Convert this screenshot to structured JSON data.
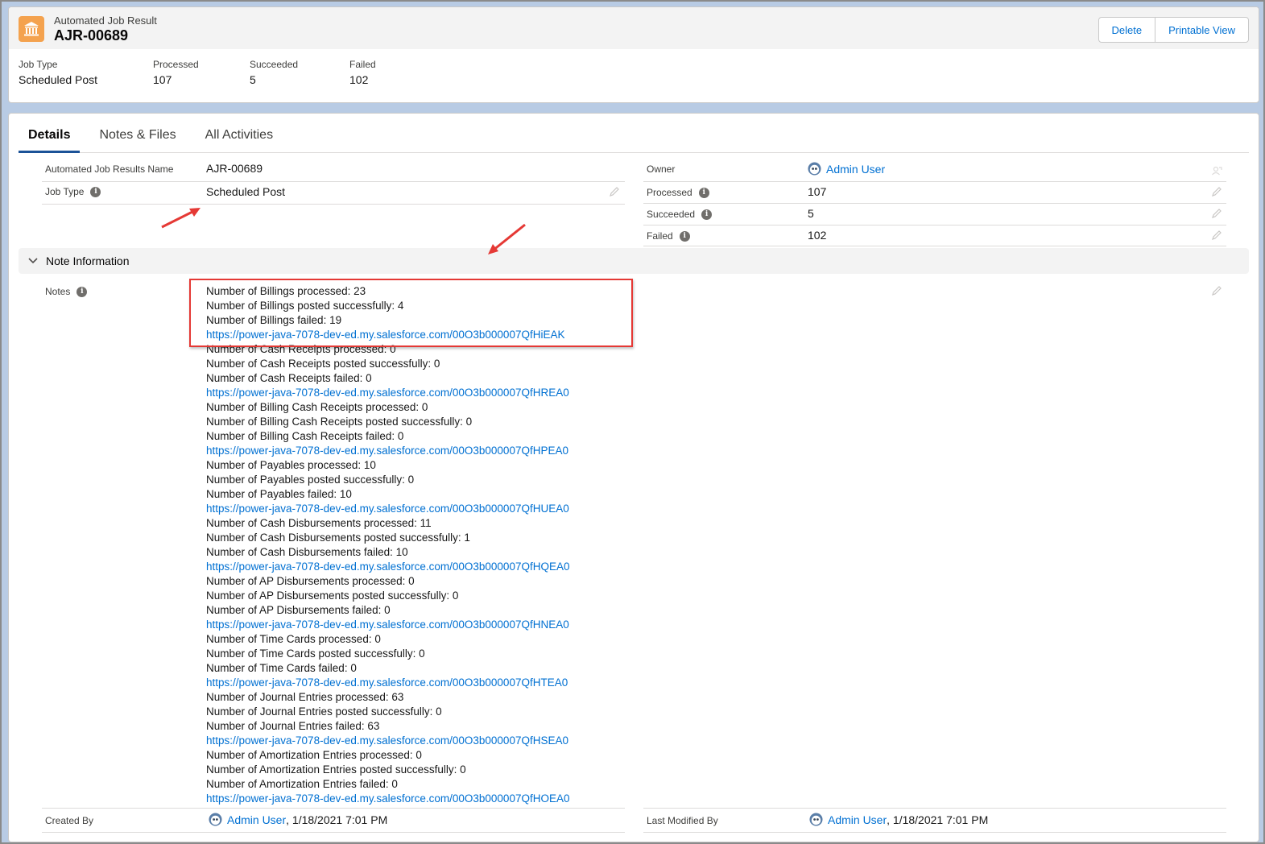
{
  "header": {
    "object_label": "Automated Job Result",
    "record_name": "AJR-00689",
    "buttons": {
      "delete": "Delete",
      "printable_view": "Printable View"
    },
    "highlights": [
      {
        "label": "Job Type",
        "value": "Scheduled Post"
      },
      {
        "label": "Processed",
        "value": "107"
      },
      {
        "label": "Succeeded",
        "value": "5"
      },
      {
        "label": "Failed",
        "value": "102"
      }
    ]
  },
  "tabs": [
    {
      "label": "Details",
      "active": true
    },
    {
      "label": "Notes & Files",
      "active": false
    },
    {
      "label": "All Activities",
      "active": false
    }
  ],
  "details": {
    "name_label": "Automated Job Results Name",
    "name_value": "AJR-00689",
    "job_type_label": "Job Type",
    "job_type_value": "Scheduled Post",
    "owner_label": "Owner",
    "owner_value": "Admin User",
    "processed_label": "Processed",
    "processed_value": "107",
    "succeeded_label": "Succeeded",
    "succeeded_value": "5",
    "failed_label": "Failed",
    "failed_value": "102"
  },
  "note_section": {
    "title": "Note Information",
    "notes_label": "Notes",
    "lines": [
      {
        "text": "Number of Billings processed: 23",
        "link": false
      },
      {
        "text": "Number of Billings posted successfully: 4",
        "link": false
      },
      {
        "text": "Number of Billings failed: 19",
        "link": false
      },
      {
        "text": "https://power-java-7078-dev-ed.my.salesforce.com/00O3b000007QfHiEAK",
        "link": true
      },
      {
        "text": "Number of Cash Receipts processed: 0",
        "link": false
      },
      {
        "text": "Number of Cash Receipts posted successfully: 0",
        "link": false
      },
      {
        "text": "Number of Cash Receipts failed: 0",
        "link": false
      },
      {
        "text": "https://power-java-7078-dev-ed.my.salesforce.com/00O3b000007QfHREA0",
        "link": true
      },
      {
        "text": "Number of Billing Cash Receipts processed: 0",
        "link": false
      },
      {
        "text": "Number of Billing Cash Receipts posted successfully: 0",
        "link": false
      },
      {
        "text": "Number of Billing Cash Receipts failed: 0",
        "link": false
      },
      {
        "text": "https://power-java-7078-dev-ed.my.salesforce.com/00O3b000007QfHPEA0",
        "link": true
      },
      {
        "text": "Number of Payables processed: 10",
        "link": false
      },
      {
        "text": "Number of Payables posted successfully: 0",
        "link": false
      },
      {
        "text": "Number of Payables failed: 10",
        "link": false
      },
      {
        "text": "https://power-java-7078-dev-ed.my.salesforce.com/00O3b000007QfHUEA0",
        "link": true
      },
      {
        "text": "Number of Cash Disbursements processed: 11",
        "link": false
      },
      {
        "text": "Number of Cash Disbursements posted successfully: 1",
        "link": false
      },
      {
        "text": "Number of Cash Disbursements failed: 10",
        "link": false
      },
      {
        "text": "https://power-java-7078-dev-ed.my.salesforce.com/00O3b000007QfHQEA0",
        "link": true
      },
      {
        "text": "Number of AP Disbursements processed: 0",
        "link": false
      },
      {
        "text": "Number of AP Disbursements posted successfully: 0",
        "link": false
      },
      {
        "text": "Number of AP Disbursements failed: 0",
        "link": false
      },
      {
        "text": "https://power-java-7078-dev-ed.my.salesforce.com/00O3b000007QfHNEA0",
        "link": true
      },
      {
        "text": "Number of Time Cards processed: 0",
        "link": false
      },
      {
        "text": "Number of Time Cards posted successfully: 0",
        "link": false
      },
      {
        "text": "Number of Time Cards failed: 0",
        "link": false
      },
      {
        "text": "https://power-java-7078-dev-ed.my.salesforce.com/00O3b000007QfHTEA0",
        "link": true
      },
      {
        "text": "Number of Journal Entries processed: 63",
        "link": false
      },
      {
        "text": "Number of Journal Entries posted successfully: 0",
        "link": false
      },
      {
        "text": "Number of Journal Entries failed: 63",
        "link": false
      },
      {
        "text": "https://power-java-7078-dev-ed.my.salesforce.com/00O3b000007QfHSEA0",
        "link": true
      },
      {
        "text": "Number of Amortization Entries processed: 0",
        "link": false
      },
      {
        "text": "Number of Amortization Entries posted successfully: 0",
        "link": false
      },
      {
        "text": "Number of Amortization Entries failed: 0",
        "link": false
      },
      {
        "text": "https://power-java-7078-dev-ed.my.salesforce.com/00O3b000007QfHOEA0",
        "link": true
      }
    ]
  },
  "system": {
    "created_by_label": "Created By",
    "created_by_user": "Admin User",
    "created_by_date": ", 1/18/2021 7:01 PM",
    "modified_by_label": "Last Modified By",
    "modified_by_user": "Admin User",
    "modified_by_date": ", 1/18/2021 7:01 PM"
  },
  "colors": {
    "brand_link": "#0070d2",
    "object_icon": "#f4a24e",
    "annotation_red": "#e53935",
    "active_tab": "#1b5297"
  },
  "icons": [
    "bank-icon",
    "info-icon",
    "pencil-icon",
    "avatar-icon",
    "chevron-down-icon",
    "change-owner-icon",
    "red-arrow"
  ]
}
